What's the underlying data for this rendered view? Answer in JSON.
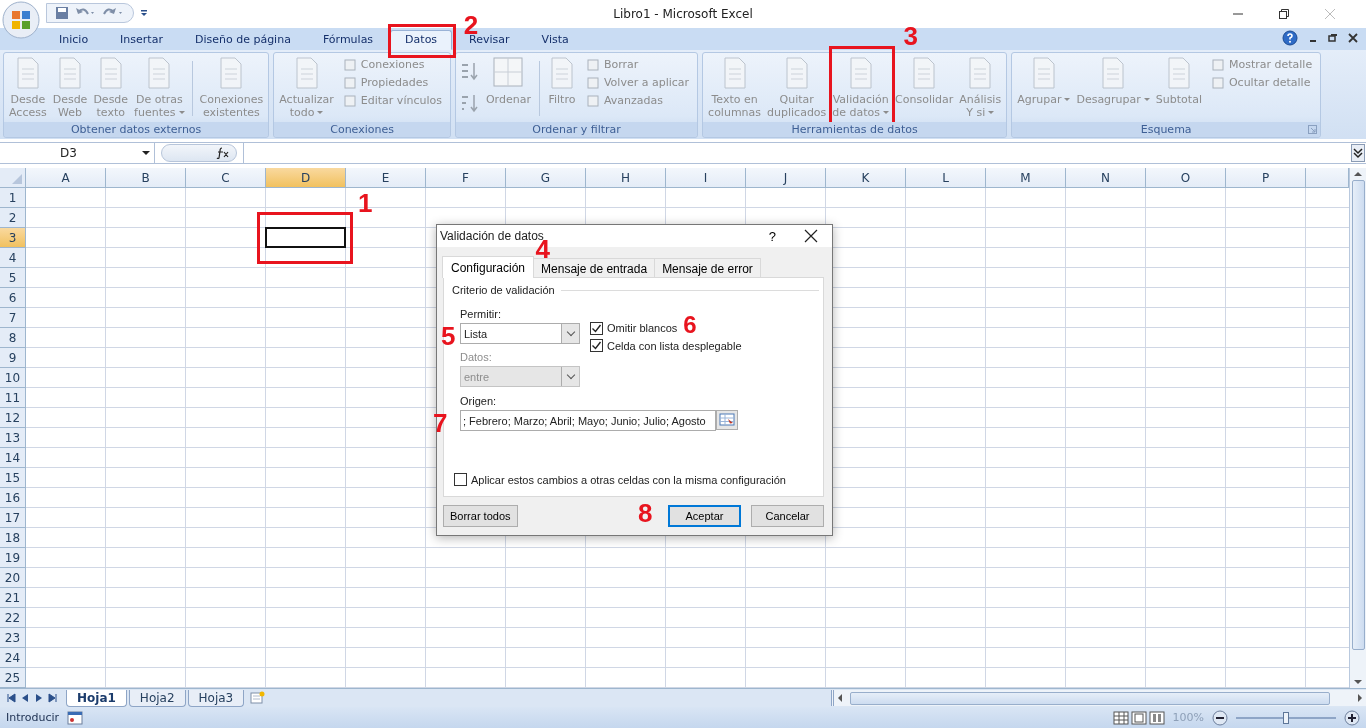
{
  "window": {
    "title": "Libro1 - Microsoft Excel"
  },
  "tabs": [
    {
      "label": "Inicio",
      "selected": false,
      "highlighted": false
    },
    {
      "label": "Insertar",
      "selected": false,
      "highlighted": false
    },
    {
      "label": "Diseño de página",
      "selected": false,
      "highlighted": false
    },
    {
      "label": "Fórmulas",
      "selected": false,
      "highlighted": false
    },
    {
      "label": "Datos",
      "selected": true,
      "highlighted": true,
      "marker": "2"
    },
    {
      "label": "Revisar",
      "selected": false,
      "highlighted": false
    },
    {
      "label": "Vista",
      "selected": false,
      "highlighted": false
    }
  ],
  "ribbon": {
    "groups": [
      {
        "label": "Obtener datos externos",
        "launcher": false,
        "items": [
          {
            "kind": "large",
            "lines": [
              "Desde",
              "Access"
            ],
            "dropdown": false,
            "disabled": true,
            "highlighted": false
          },
          {
            "kind": "large",
            "lines": [
              "Desde",
              "Web"
            ],
            "dropdown": false,
            "disabled": true,
            "highlighted": false
          },
          {
            "kind": "large",
            "lines": [
              "Desde",
              "texto"
            ],
            "dropdown": false,
            "disabled": true,
            "highlighted": false
          },
          {
            "kind": "large",
            "lines": [
              "De otras",
              "fuentes"
            ],
            "dropdown": true,
            "disabled": true,
            "highlighted": false
          },
          {
            "kind": "separator"
          },
          {
            "kind": "large",
            "lines": [
              "Conexiones",
              "existentes"
            ],
            "dropdown": false,
            "disabled": true,
            "highlighted": false
          }
        ]
      },
      {
        "label": "Conexiones",
        "launcher": false,
        "items": [
          {
            "kind": "large",
            "lines": [
              "Actualizar",
              "todo"
            ],
            "dropdown": true,
            "disabled": true,
            "highlighted": false
          },
          {
            "kind": "small-stack",
            "items": [
              {
                "label": "Conexiones",
                "disabled": true
              },
              {
                "label": "Propiedades",
                "disabled": true
              },
              {
                "label": "Editar vínculos",
                "disabled": true
              }
            ]
          }
        ]
      },
      {
        "label": "Ordenar y filtrar",
        "launcher": false,
        "items": [
          {
            "kind": "sort-pair"
          },
          {
            "kind": "wide",
            "label": "Ordenar",
            "disabled": true
          },
          {
            "kind": "separator"
          },
          {
            "kind": "large",
            "lines": [
              "Filtro"
            ],
            "dropdown": false,
            "disabled": true,
            "highlighted": false
          },
          {
            "kind": "small-stack",
            "items": [
              {
                "label": "Borrar",
                "disabled": true
              },
              {
                "label": "Volver a aplicar",
                "disabled": true
              },
              {
                "label": "Avanzadas",
                "disabled": true
              }
            ]
          }
        ]
      },
      {
        "label": "Herramientas de datos",
        "launcher": false,
        "items": [
          {
            "kind": "large",
            "lines": [
              "Texto en",
              "columnas"
            ],
            "dropdown": false,
            "disabled": true,
            "highlighted": false
          },
          {
            "kind": "large",
            "lines": [
              "Quitar",
              "duplicados"
            ],
            "dropdown": false,
            "disabled": true,
            "highlighted": false
          },
          {
            "kind": "large",
            "lines": [
              "Validación",
              "de datos"
            ],
            "dropdown": true,
            "disabled": true,
            "highlighted": true,
            "marker": "3"
          },
          {
            "kind": "large",
            "lines": [
              "Consolidar"
            ],
            "dropdown": false,
            "disabled": true,
            "highlighted": false
          },
          {
            "kind": "large",
            "lines": [
              "Análisis",
              "Y si"
            ],
            "dropdown": true,
            "disabled": true,
            "highlighted": false
          }
        ]
      },
      {
        "label": "Esquema",
        "launcher": true,
        "items": [
          {
            "kind": "large",
            "lines": [
              "Agrupar"
            ],
            "dropdown": true,
            "disabled": true,
            "highlighted": false
          },
          {
            "kind": "large",
            "lines": [
              "Desagrupar"
            ],
            "dropdown": true,
            "disabled": true,
            "highlighted": false
          },
          {
            "kind": "large",
            "lines": [
              "Subtotal"
            ],
            "dropdown": false,
            "disabled": true,
            "highlighted": false
          },
          {
            "kind": "small-stack",
            "items": [
              {
                "label": "Mostrar detalle",
                "disabled": true
              },
              {
                "label": "Ocultar detalle",
                "disabled": true
              }
            ]
          }
        ]
      }
    ]
  },
  "formula_bar": {
    "name_box": "D3"
  },
  "sheet": {
    "columns": [
      {
        "label": "A",
        "selected": false
      },
      {
        "label": "B",
        "selected": false
      },
      {
        "label": "C",
        "selected": false
      },
      {
        "label": "D",
        "selected": true
      },
      {
        "label": "E",
        "selected": false
      },
      {
        "label": "F",
        "selected": false
      },
      {
        "label": "G",
        "selected": false
      },
      {
        "label": "H",
        "selected": false
      },
      {
        "label": "I",
        "selected": false
      },
      {
        "label": "J",
        "selected": false
      },
      {
        "label": "K",
        "selected": false
      },
      {
        "label": "L",
        "selected": false
      },
      {
        "label": "M",
        "selected": false
      },
      {
        "label": "N",
        "selected": false
      },
      {
        "label": "O",
        "selected": false
      },
      {
        "label": "P",
        "selected": false
      }
    ],
    "rows": [
      {
        "label": "1",
        "selected": false
      },
      {
        "label": "2",
        "selected": false
      },
      {
        "label": "3",
        "selected": true
      },
      {
        "label": "4",
        "selected": false
      },
      {
        "label": "5",
        "selected": false
      },
      {
        "label": "6",
        "selected": false
      },
      {
        "label": "7",
        "selected": false
      },
      {
        "label": "8",
        "selected": false
      },
      {
        "label": "9",
        "selected": false
      },
      {
        "label": "10",
        "selected": false
      },
      {
        "label": "11",
        "selected": false
      },
      {
        "label": "12",
        "selected": false
      },
      {
        "label": "13",
        "selected": false
      },
      {
        "label": "14",
        "selected": false
      },
      {
        "label": "15",
        "selected": false
      },
      {
        "label": "16",
        "selected": false
      },
      {
        "label": "17",
        "selected": false
      },
      {
        "label": "18",
        "selected": false
      },
      {
        "label": "19",
        "selected": false
      },
      {
        "label": "20",
        "selected": false
      },
      {
        "label": "21",
        "selected": false
      },
      {
        "label": "22",
        "selected": false
      },
      {
        "label": "23",
        "selected": false
      },
      {
        "label": "24",
        "selected": false
      },
      {
        "label": "25",
        "selected": false
      }
    ],
    "active_cell": {
      "highlighted": true,
      "marker": "1"
    }
  },
  "sheet_tabs": [
    {
      "label": "Hoja1",
      "selected": true
    },
    {
      "label": "Hoja2",
      "selected": false
    },
    {
      "label": "Hoja3",
      "selected": false
    }
  ],
  "status_bar": {
    "mode": "Introducir",
    "zoom": "100%",
    "zoom_level": {
      "level": 0.5
    }
  },
  "dialog": {
    "title": "Validación de datos",
    "help": "?",
    "tabs": [
      {
        "label": "Configuración",
        "selected": true,
        "marker": "4"
      },
      {
        "label": "Mensaje de entrada",
        "selected": false
      },
      {
        "label": "Mensaje de error",
        "selected": false
      }
    ],
    "section": "Criterio de validación",
    "allow": {
      "label": "Permitir:",
      "value": "Lista",
      "disabled": false,
      "marker": "5"
    },
    "data": {
      "label": "Datos:",
      "value": "entre",
      "disabled": true
    },
    "checkboxes": [
      {
        "label": "Omitir blancos",
        "checked": true,
        "marker": "6"
      },
      {
        "label": "Celda con lista desplegable",
        "checked": true
      }
    ],
    "source": {
      "label": "Origen:",
      "value": "; Febrero; Marzo; Abril; Mayo; Junio; Julio; Agosto",
      "marker": "7"
    },
    "apply_all": {
      "label": "Aplicar estos cambios a otras celdas con la misma configuración",
      "checked": false
    },
    "buttons": [
      {
        "label": "Borrar todos",
        "kind": "left",
        "default": false
      },
      {
        "label": "Aceptar",
        "kind": "right",
        "default": true,
        "marker": "8"
      },
      {
        "label": "Cancelar",
        "kind": "right",
        "default": false
      }
    ]
  }
}
